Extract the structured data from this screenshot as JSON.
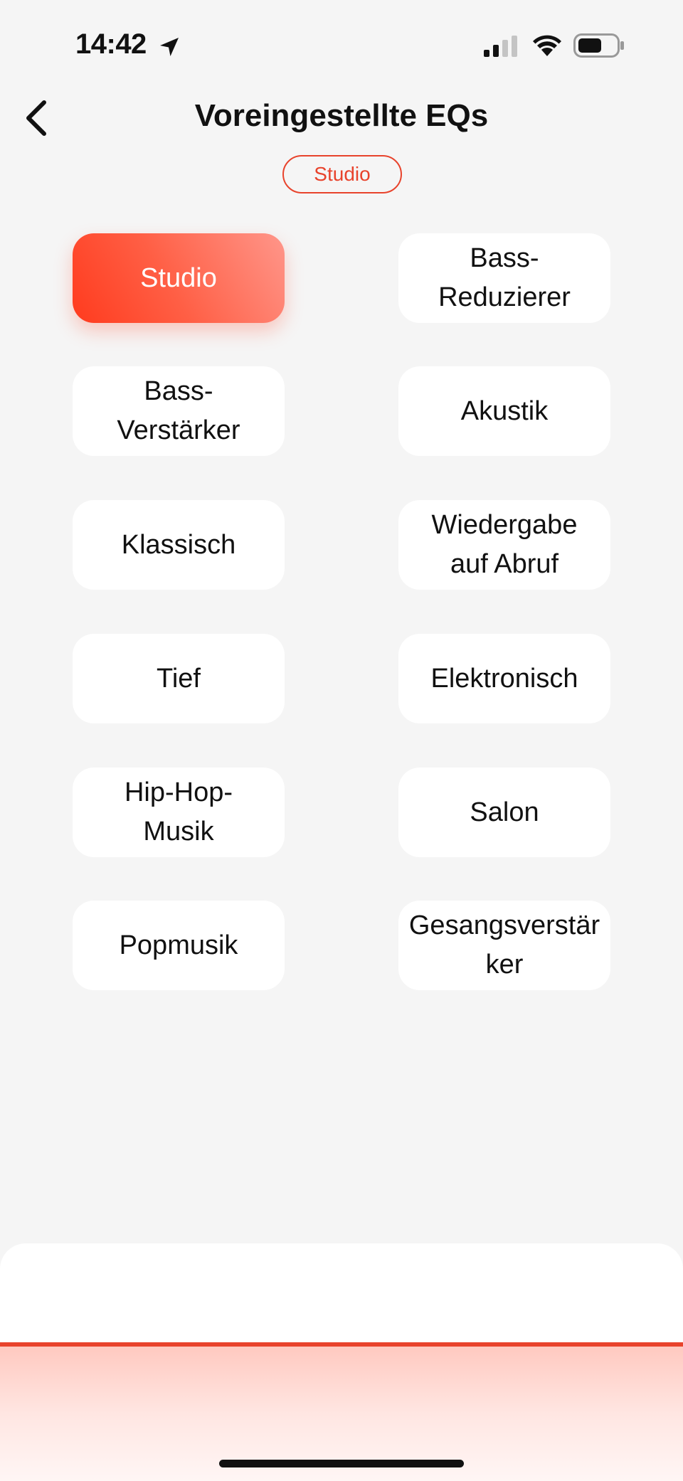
{
  "status_bar": {
    "time": "14:42",
    "icons": [
      "location-arrow-icon",
      "cellular-signal-icon",
      "wifi-icon",
      "battery-icon"
    ]
  },
  "header": {
    "back_icon": "chevron-left-icon",
    "title": "Voreingestellte EQs",
    "current_preset": "Studio"
  },
  "presets": [
    {
      "label": "Studio",
      "selected": true
    },
    {
      "label": "Bass-\nReduzierer",
      "selected": false
    },
    {
      "label": "Bass-\nVerstärker",
      "selected": false
    },
    {
      "label": "Akustik",
      "selected": false
    },
    {
      "label": "Klassisch",
      "selected": false
    },
    {
      "label": "Wiedergabe\nauf Abruf",
      "selected": false
    },
    {
      "label": "Tief",
      "selected": false
    },
    {
      "label": "Elektronisch",
      "selected": false
    },
    {
      "label": "Hip-Hop-\nMusik",
      "selected": false
    },
    {
      "label": "Salon",
      "selected": false
    },
    {
      "label": "Popmusik",
      "selected": false
    },
    {
      "label": "Gesangsverstär\nker",
      "selected": false
    }
  ],
  "colors": {
    "accent": "#e8432c",
    "background": "#f5f5f5",
    "tile": "#ffffff",
    "text": "#111111"
  }
}
